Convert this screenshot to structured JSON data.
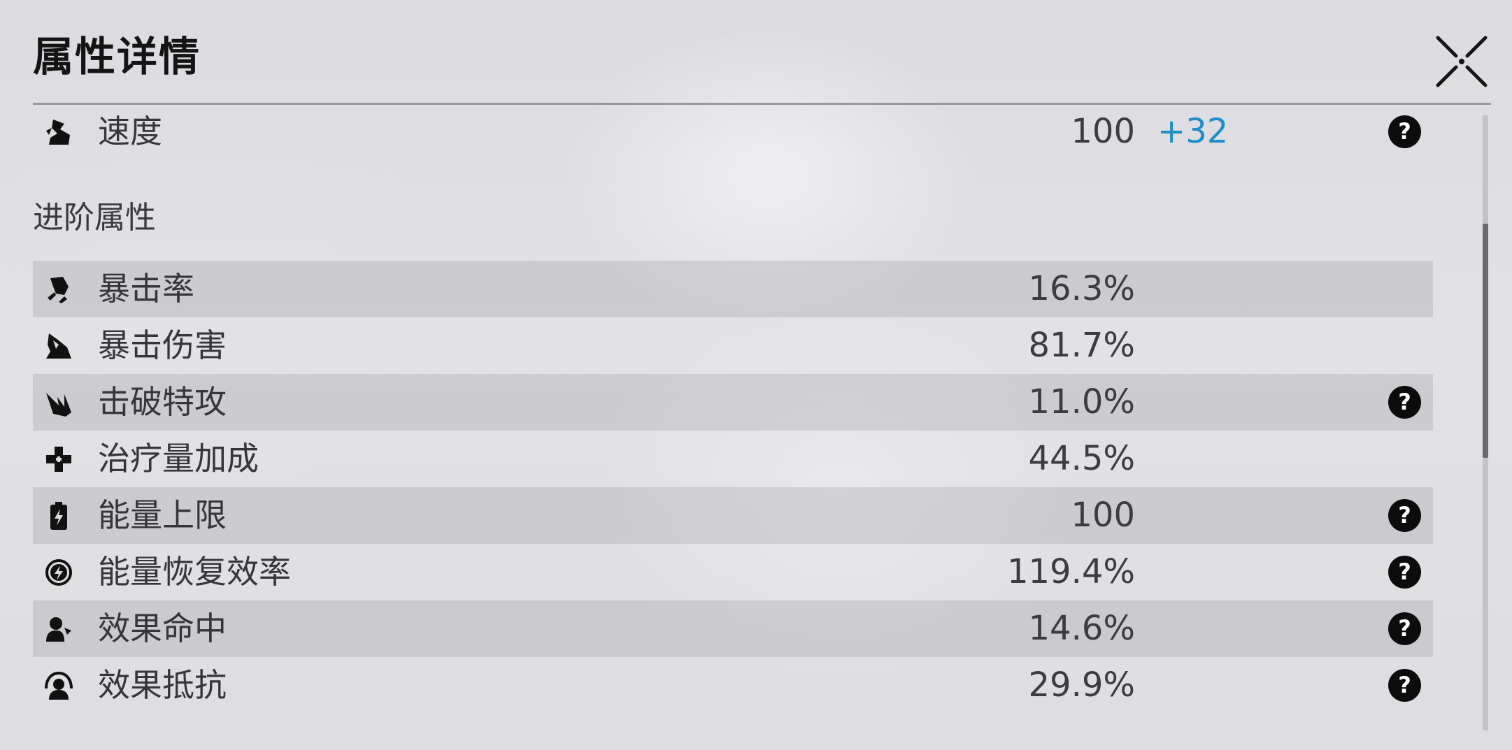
{
  "window": {
    "title": "属性详情",
    "close_icon": "close-x-icon"
  },
  "speed_row": {
    "icon": "speed-icon",
    "label": "速度",
    "value": "100",
    "bonus": "+32",
    "bonus_color": "#1e8ec8",
    "help": "?"
  },
  "advanced": {
    "heading": "进阶属性",
    "rows": [
      {
        "icon": "crit-rate-icon",
        "label": "暴击率",
        "value": "16.3%"
      },
      {
        "icon": "crit-damage-icon",
        "label": "暴击伤害",
        "value": "81.7%"
      },
      {
        "icon": "break-effect-icon",
        "label": "击破特攻",
        "value": "11.0%",
        "help": "?"
      },
      {
        "icon": "healing-bonus-icon",
        "label": "治疗量加成",
        "value": "44.5%"
      },
      {
        "icon": "max-energy-icon",
        "label": "能量上限",
        "value": "100",
        "help": "?"
      },
      {
        "icon": "energy-regen-icon",
        "label": "能量恢复效率",
        "value": "119.4%",
        "help": "?"
      },
      {
        "icon": "effect-hit-icon",
        "label": "效果命中",
        "value": "14.6%",
        "help": "?"
      },
      {
        "icon": "effect-res-icon",
        "label": "效果抵抗",
        "value": "29.9%",
        "help": "?"
      }
    ]
  },
  "scrollbar": {
    "thumb_position_fraction": 0.18
  }
}
